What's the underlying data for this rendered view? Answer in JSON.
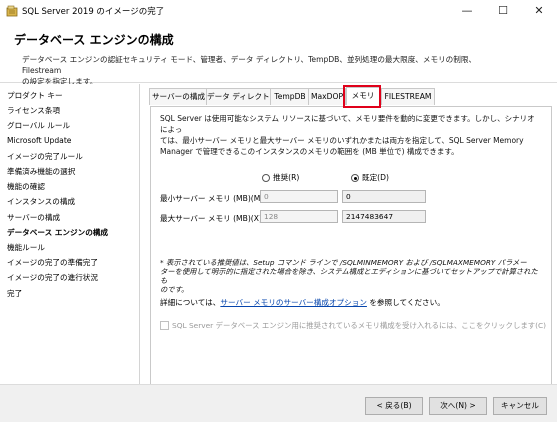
{
  "window": {
    "title": "SQL Server 2019 のイメージの完了",
    "controls": {
      "minimize": "—",
      "maximize": "☐",
      "close": "✕"
    }
  },
  "header": {
    "title": "データベース エンジンの構成",
    "description_line1": "データベース エンジンの認証セキュリティ モード、管理者、データ ディレクトリ、TempDB、並列処理の最大限度、メモリの制限、Filestream",
    "description_line2": "の設定を指定します。"
  },
  "sidebar": {
    "items": [
      {
        "label": "プロダクト キー"
      },
      {
        "label": "ライセンス条項"
      },
      {
        "label": "グローバル ルール"
      },
      {
        "label": "Microsoft Update"
      },
      {
        "label": "イメージの完了ルール"
      },
      {
        "label": "準備済み機能の選択"
      },
      {
        "label": "機能の確認"
      },
      {
        "label": "インスタンスの構成"
      },
      {
        "label": "サーバーの構成"
      },
      {
        "label": "データベース エンジンの構成"
      },
      {
        "label": "機能ルール"
      },
      {
        "label": "イメージの完了の準備完了"
      },
      {
        "label": "イメージの完了の進行状況"
      },
      {
        "label": "完了"
      }
    ],
    "active_index": 9
  },
  "tabs": [
    {
      "label": "サーバーの構成"
    },
    {
      "label": "データ ディレクトリ"
    },
    {
      "label": "TempDB"
    },
    {
      "label": "MaxDOP"
    },
    {
      "label": "メモリ"
    },
    {
      "label": "FILESTREAM"
    }
  ],
  "selected_tab": "メモリ",
  "memory": {
    "intro_line1": "SQL Server は使用可能なシステム リソースに基づいて、メモリ要件を動的に変更できます。しかし、シナリオによっ",
    "intro_line2": "ては、最小サーバー メモリと最大サーバー メモリのいずれかまたは両方を指定して、SQL Server Memory",
    "intro_line3": "Manager で管理できるこのインスタンスのメモリの範囲を (MB 単位で) 構成できます。",
    "radio_recommended": "推奨(R)",
    "radio_default": "既定(D)",
    "selected_radio": "default",
    "min_label": "最小サーバー メモリ (MB)(M):",
    "min_recommended": "0",
    "min_value": "0",
    "max_label": "最大サーバー メモリ (MB)(X):",
    "max_recommended": "128",
    "max_value": "2147483647",
    "note_line1": "* 表示されている推奨値は、Setup コマンド ラインで /SQLMINMEMORY および /SQLMAXMEMORY パラメー",
    "note_line2": "ターを使用して明示的に指定された場合を除き、システム構成とエディションに基づいてセットアップで計算されたも",
    "note_line3": "のです。",
    "details_prefix": "詳細については、",
    "details_link": "サーバー メモリのサーバー構成オプション",
    "details_suffix": " を参照してください。",
    "accept_label": "SQL Server データベース エンジン用に推奨されているメモリ構成を受け入れるには、ここをクリックします(C)"
  },
  "footer": {
    "back": "< 戻る(B)",
    "next": "次へ(N) >",
    "cancel": "キャンセル"
  },
  "colors": {
    "highlight": "#e0001a",
    "link": "#0645ad",
    "icon": "#c6a43a"
  },
  "icons": {
    "app": "sql-server-setup-icon"
  }
}
